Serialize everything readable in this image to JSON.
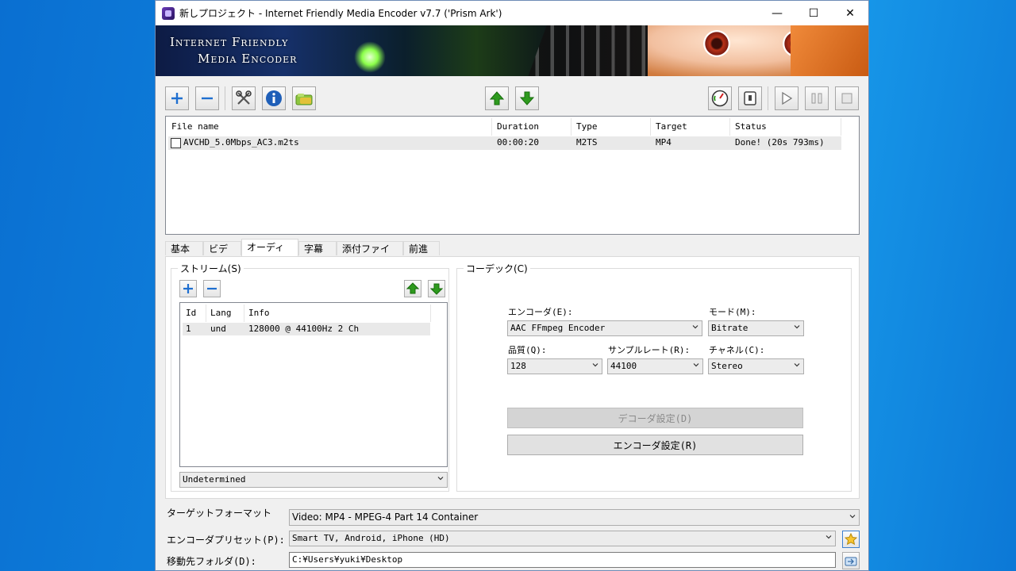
{
  "window": {
    "title": "新しプロジェクト - Internet Friendly Media Encoder v7.7 ('Prism Ark')",
    "minimize": "—",
    "maximize": "☐",
    "close": "✕"
  },
  "banner": {
    "logo_line1": "Internet Friendly",
    "logo_line2": "Media Encoder"
  },
  "toolbar": {
    "icons": [
      "add-icon",
      "remove-icon",
      "tools-icon",
      "info-icon",
      "folder-icon",
      "move-up-icon",
      "move-down-icon",
      "gauge-icon",
      "shutdown-icon",
      "play-icon",
      "pause-icon",
      "stop-icon"
    ]
  },
  "file_list": {
    "columns": [
      "File name",
      "Duration",
      "Type",
      "Target",
      "Status"
    ],
    "rows": [
      {
        "name": "AVCHD_5.0Mbps_AC3.m2ts",
        "duration": "00:00:20",
        "type": "M2TS",
        "target": "MP4",
        "status": "Done! (20s 793ms)"
      }
    ]
  },
  "tabs": [
    "基本",
    "ビデオ",
    "オーディオ",
    "字幕",
    "添付ファイル",
    "前進"
  ],
  "active_tab": "オーディオ",
  "stream": {
    "group_label": "ストリーム(S)",
    "columns": [
      "Id",
      "Lang",
      "Info"
    ],
    "rows": [
      {
        "id": "1",
        "lang": "und",
        "info": "128000 @ 44100Hz 2 Ch"
      }
    ],
    "language": "Undetermined"
  },
  "codec": {
    "group_label": "コーデック(C)",
    "encoder_label": "エンコーダ(E):",
    "encoder_value": "AAC FFmpeg Encoder",
    "mode_label": "モード(M):",
    "mode_value": "Bitrate",
    "quality_label": "品質(Q):",
    "quality_value": "128",
    "samplerate_label": "サンプルレート(R):",
    "samplerate_value": "44100",
    "channel_label": "チャネル(C):",
    "channel_value": "Stereo",
    "decoder_settings": "デコーダ設定(D)",
    "encoder_settings": "エンコーダ設定(R)"
  },
  "bottom": {
    "target_format_label": "ターゲットフォーマット",
    "target_format_value": "Video: MP4 - MPEG-4 Part 14 Container",
    "preset_label": "エンコーダプリセット(P):",
    "preset_value": "Smart TV, Android, iPhone (HD)",
    "dest_label": "移動先フォルダ(D):",
    "dest_value": "C:¥Users¥yuki¥Desktop"
  },
  "colors": {
    "accent_green": "#2e9a1e",
    "accent_blue": "#1f6fd0"
  }
}
